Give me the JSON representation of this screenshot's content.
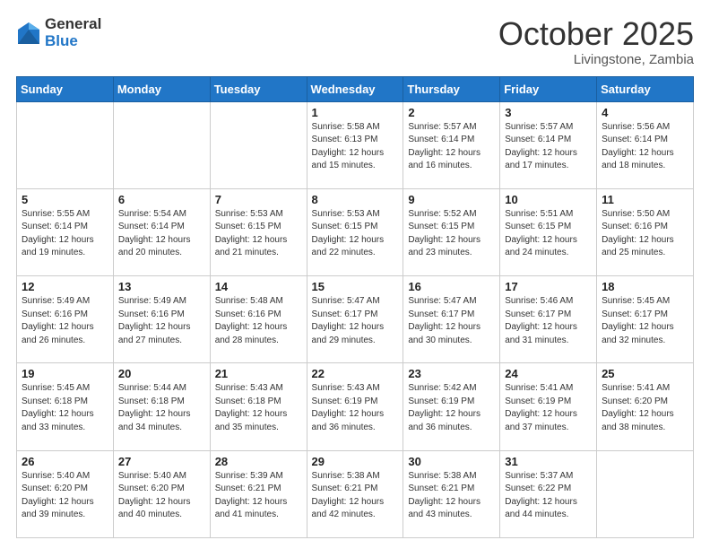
{
  "logo": {
    "general": "General",
    "blue": "Blue"
  },
  "title": "October 2025",
  "location": "Livingstone, Zambia",
  "days_of_week": [
    "Sunday",
    "Monday",
    "Tuesday",
    "Wednesday",
    "Thursday",
    "Friday",
    "Saturday"
  ],
  "weeks": [
    [
      {
        "day": "",
        "info": ""
      },
      {
        "day": "",
        "info": ""
      },
      {
        "day": "",
        "info": ""
      },
      {
        "day": "1",
        "info": "Sunrise: 5:58 AM\nSunset: 6:13 PM\nDaylight: 12 hours\nand 15 minutes."
      },
      {
        "day": "2",
        "info": "Sunrise: 5:57 AM\nSunset: 6:14 PM\nDaylight: 12 hours\nand 16 minutes."
      },
      {
        "day": "3",
        "info": "Sunrise: 5:57 AM\nSunset: 6:14 PM\nDaylight: 12 hours\nand 17 minutes."
      },
      {
        "day": "4",
        "info": "Sunrise: 5:56 AM\nSunset: 6:14 PM\nDaylight: 12 hours\nand 18 minutes."
      }
    ],
    [
      {
        "day": "5",
        "info": "Sunrise: 5:55 AM\nSunset: 6:14 PM\nDaylight: 12 hours\nand 19 minutes."
      },
      {
        "day": "6",
        "info": "Sunrise: 5:54 AM\nSunset: 6:14 PM\nDaylight: 12 hours\nand 20 minutes."
      },
      {
        "day": "7",
        "info": "Sunrise: 5:53 AM\nSunset: 6:15 PM\nDaylight: 12 hours\nand 21 minutes."
      },
      {
        "day": "8",
        "info": "Sunrise: 5:53 AM\nSunset: 6:15 PM\nDaylight: 12 hours\nand 22 minutes."
      },
      {
        "day": "9",
        "info": "Sunrise: 5:52 AM\nSunset: 6:15 PM\nDaylight: 12 hours\nand 23 minutes."
      },
      {
        "day": "10",
        "info": "Sunrise: 5:51 AM\nSunset: 6:15 PM\nDaylight: 12 hours\nand 24 minutes."
      },
      {
        "day": "11",
        "info": "Sunrise: 5:50 AM\nSunset: 6:16 PM\nDaylight: 12 hours\nand 25 minutes."
      }
    ],
    [
      {
        "day": "12",
        "info": "Sunrise: 5:49 AM\nSunset: 6:16 PM\nDaylight: 12 hours\nand 26 minutes."
      },
      {
        "day": "13",
        "info": "Sunrise: 5:49 AM\nSunset: 6:16 PM\nDaylight: 12 hours\nand 27 minutes."
      },
      {
        "day": "14",
        "info": "Sunrise: 5:48 AM\nSunset: 6:16 PM\nDaylight: 12 hours\nand 28 minutes."
      },
      {
        "day": "15",
        "info": "Sunrise: 5:47 AM\nSunset: 6:17 PM\nDaylight: 12 hours\nand 29 minutes."
      },
      {
        "day": "16",
        "info": "Sunrise: 5:47 AM\nSunset: 6:17 PM\nDaylight: 12 hours\nand 30 minutes."
      },
      {
        "day": "17",
        "info": "Sunrise: 5:46 AM\nSunset: 6:17 PM\nDaylight: 12 hours\nand 31 minutes."
      },
      {
        "day": "18",
        "info": "Sunrise: 5:45 AM\nSunset: 6:17 PM\nDaylight: 12 hours\nand 32 minutes."
      }
    ],
    [
      {
        "day": "19",
        "info": "Sunrise: 5:45 AM\nSunset: 6:18 PM\nDaylight: 12 hours\nand 33 minutes."
      },
      {
        "day": "20",
        "info": "Sunrise: 5:44 AM\nSunset: 6:18 PM\nDaylight: 12 hours\nand 34 minutes."
      },
      {
        "day": "21",
        "info": "Sunrise: 5:43 AM\nSunset: 6:18 PM\nDaylight: 12 hours\nand 35 minutes."
      },
      {
        "day": "22",
        "info": "Sunrise: 5:43 AM\nSunset: 6:19 PM\nDaylight: 12 hours\nand 36 minutes."
      },
      {
        "day": "23",
        "info": "Sunrise: 5:42 AM\nSunset: 6:19 PM\nDaylight: 12 hours\nand 36 minutes."
      },
      {
        "day": "24",
        "info": "Sunrise: 5:41 AM\nSunset: 6:19 PM\nDaylight: 12 hours\nand 37 minutes."
      },
      {
        "day": "25",
        "info": "Sunrise: 5:41 AM\nSunset: 6:20 PM\nDaylight: 12 hours\nand 38 minutes."
      }
    ],
    [
      {
        "day": "26",
        "info": "Sunrise: 5:40 AM\nSunset: 6:20 PM\nDaylight: 12 hours\nand 39 minutes."
      },
      {
        "day": "27",
        "info": "Sunrise: 5:40 AM\nSunset: 6:20 PM\nDaylight: 12 hours\nand 40 minutes."
      },
      {
        "day": "28",
        "info": "Sunrise: 5:39 AM\nSunset: 6:21 PM\nDaylight: 12 hours\nand 41 minutes."
      },
      {
        "day": "29",
        "info": "Sunrise: 5:38 AM\nSunset: 6:21 PM\nDaylight: 12 hours\nand 42 minutes."
      },
      {
        "day": "30",
        "info": "Sunrise: 5:38 AM\nSunset: 6:21 PM\nDaylight: 12 hours\nand 43 minutes."
      },
      {
        "day": "31",
        "info": "Sunrise: 5:37 AM\nSunset: 6:22 PM\nDaylight: 12 hours\nand 44 minutes."
      },
      {
        "day": "",
        "info": ""
      }
    ]
  ]
}
